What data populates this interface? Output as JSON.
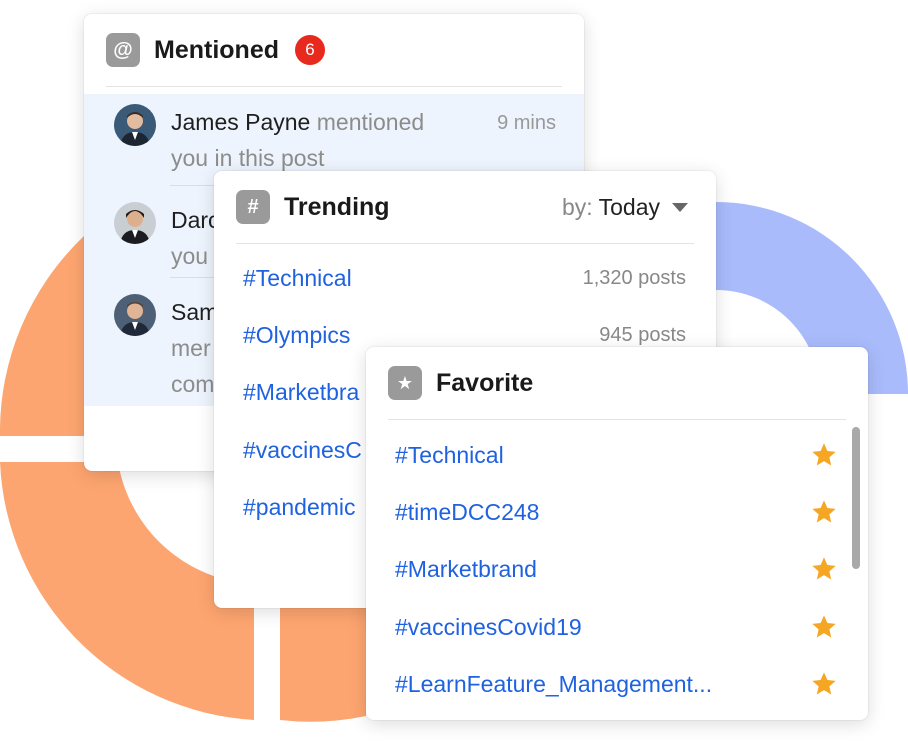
{
  "colors": {
    "accent_link": "#1f62e0",
    "badge_red": "#e8291d",
    "star_gold": "#f5a623",
    "deco_orange": "#fda570",
    "deco_blue": "#a9bbfb",
    "icon_gray": "#9a9a9a"
  },
  "mentioned": {
    "icon": "at-icon",
    "icon_glyph": "@",
    "title": "Mentioned",
    "badge": "6",
    "items": [
      {
        "name": "James Payne",
        "text_line1": " mentioned",
        "text_line2": "you in this post",
        "time": "9 mins"
      },
      {
        "name": "Darc",
        "text_line1": "",
        "text_line2": "you",
        "time": ""
      },
      {
        "name": "Sam",
        "text_line1": "",
        "text_line2": "mer",
        "text_line3": "com",
        "time": ""
      }
    ]
  },
  "trending": {
    "icon": "hash-icon",
    "icon_glyph": "#",
    "title": "Trending",
    "sort_label": "by:",
    "sort_value": "Today",
    "items": [
      {
        "tag": "#Technical",
        "count": "1,320 posts"
      },
      {
        "tag": "#Olympics",
        "count": "945 posts"
      },
      {
        "tag": "#Marketbra",
        "count": ""
      },
      {
        "tag": "#vaccinesC",
        "count": ""
      },
      {
        "tag": "#pandemic",
        "count": ""
      }
    ]
  },
  "favorite": {
    "icon": "star-icon",
    "icon_glyph": "★",
    "title": "Favorite",
    "items": [
      {
        "tag": "#Technical"
      },
      {
        "tag": "#timeDCC248"
      },
      {
        "tag": "#Marketbrand"
      },
      {
        "tag": "#vaccinesCovid19"
      },
      {
        "tag": "#LearnFeature_Management..."
      }
    ]
  }
}
